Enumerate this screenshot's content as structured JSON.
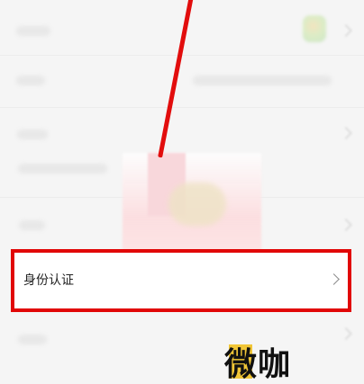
{
  "identity_verification_row": {
    "label": "身份认证"
  },
  "watermark": {
    "text": "微咖"
  }
}
